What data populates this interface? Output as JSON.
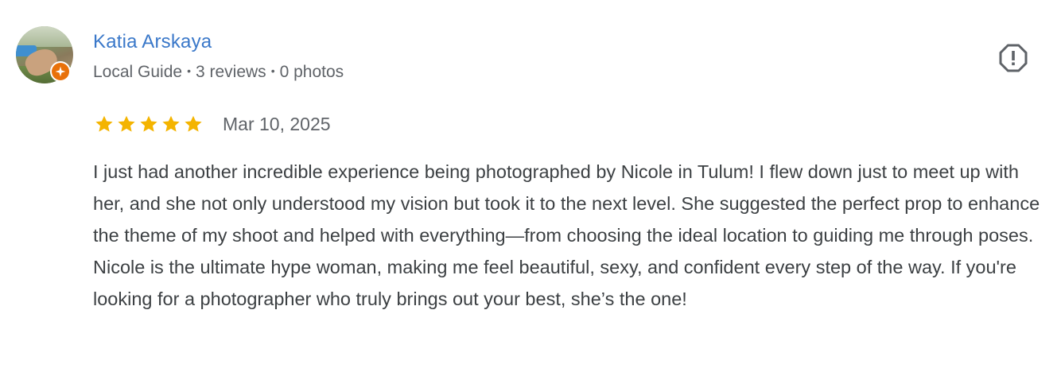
{
  "review": {
    "reviewer_name": "Katia Arskaya",
    "meta": {
      "role": "Local Guide",
      "reviews": "3 reviews",
      "photos": "0 photos",
      "separator": "•"
    },
    "rating": 5,
    "rating_max": 5,
    "date": "Mar 10, 2025",
    "text": "I just had another incredible experience being photographed by Nicole in Tulum! I flew down just to meet up with her, and she not only understood my vision but took it to the next level. She suggested the perfect prop to enhance the theme of my shoot and helped with everything—from choosing the ideal location to guiding me through poses. Nicole is the ultimate hype woman, making me feel beautiful, sexy, and confident every step of the way. If you're looking for a photographer who truly brings out your best, she’s the one!"
  },
  "icons": {
    "report": "report-icon",
    "guide_badge": "local-guide-badge-icon",
    "star": "star-icon"
  },
  "colors": {
    "name": "#3a78c9",
    "star": "#f4b400",
    "badge": "#e8710a",
    "meta": "#5f6368",
    "text": "#3c4043"
  }
}
